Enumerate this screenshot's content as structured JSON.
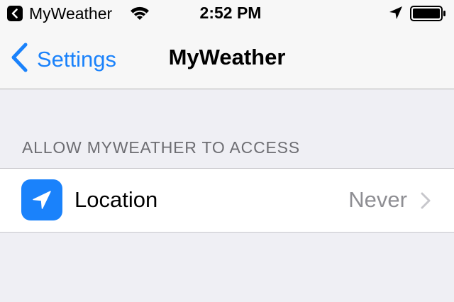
{
  "status_bar": {
    "back_app_name": "MyWeather",
    "time": "2:52 PM"
  },
  "nav": {
    "back_label": "Settings",
    "title": "MyWeather"
  },
  "section": {
    "header": "ALLOW MYWEATHER TO ACCESS",
    "rows": [
      {
        "label": "Location",
        "value": "Never",
        "icon": "location-arrow-icon"
      }
    ]
  },
  "colors": {
    "accent": "#1a82fb",
    "secondary_text": "#8e8e93",
    "section_header_text": "#6d6d72",
    "grouped_background": "#efeff4"
  }
}
